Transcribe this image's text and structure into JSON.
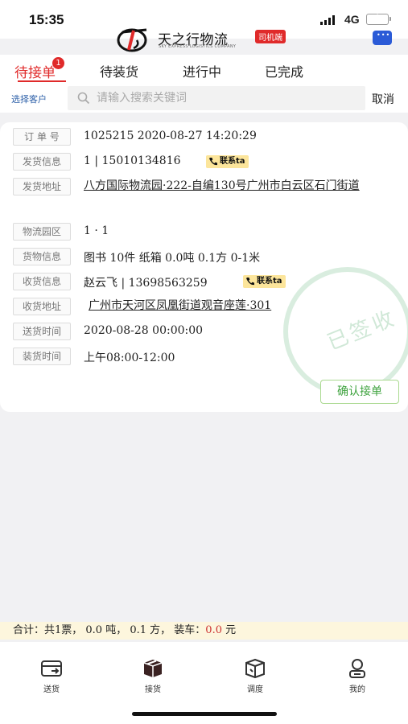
{
  "status": {
    "time": "15:35",
    "network": "4G"
  },
  "header": {
    "logo_text": "天之行物流",
    "logo_subtitle": "SKY EXPRESS LOGISTICS COMPANY",
    "badge": "司机端"
  },
  "tabs": [
    {
      "label": "待接单",
      "badge": "1",
      "active": true
    },
    {
      "label": "待装货"
    },
    {
      "label": "进行中"
    },
    {
      "label": "已完成"
    }
  ],
  "search": {
    "customer_label": "选择客户",
    "placeholder": "请输入搜索关键词",
    "cancel_label": "取消"
  },
  "order": {
    "rows": [
      {
        "label": "订 单 号",
        "value": "1025215   2020-08-27 14:20:29"
      },
      {
        "label": "发货信息",
        "value": "1 | 15010134816",
        "contact": "联系ta"
      },
      {
        "label": "发货地址",
        "value": "八方国际物流园·222-自编130号广州市白云区石门街道"
      },
      {
        "label": "物流园区",
        "value": "1 · 1"
      },
      {
        "label": "货物信息",
        "value": "图书 10件 纸箱 0.0吨 0.1方 0-1米"
      },
      {
        "label": "收货信息",
        "value": "赵云飞 | 13698563259",
        "contact": "联系ta"
      },
      {
        "label": "收货地址",
        "value": "广州市天河区凤凰街道观音座莲·301"
      },
      {
        "label": "送货时间",
        "value": "2020-08-28 00:00:00"
      },
      {
        "label": "装货时间",
        "value": "上午08:00-12:00"
      }
    ],
    "confirm_label": "确认接单",
    "stamp_text": "已签收"
  },
  "summary": {
    "prefix": "合计：共1票，  0.0 吨，  0.1 方，  装车：",
    "loaded": "0.0",
    "suffix": " 元"
  },
  "bottom_nav": [
    {
      "label": "送货"
    },
    {
      "label": "接货",
      "active": true
    },
    {
      "label": "调度"
    },
    {
      "label": "我的"
    }
  ],
  "colors": {
    "accent_red": "#e02a2a",
    "confirm_green": "#3fa33f",
    "link_blue": "#2c5fa8",
    "contact_yellow": "#fce59b"
  }
}
